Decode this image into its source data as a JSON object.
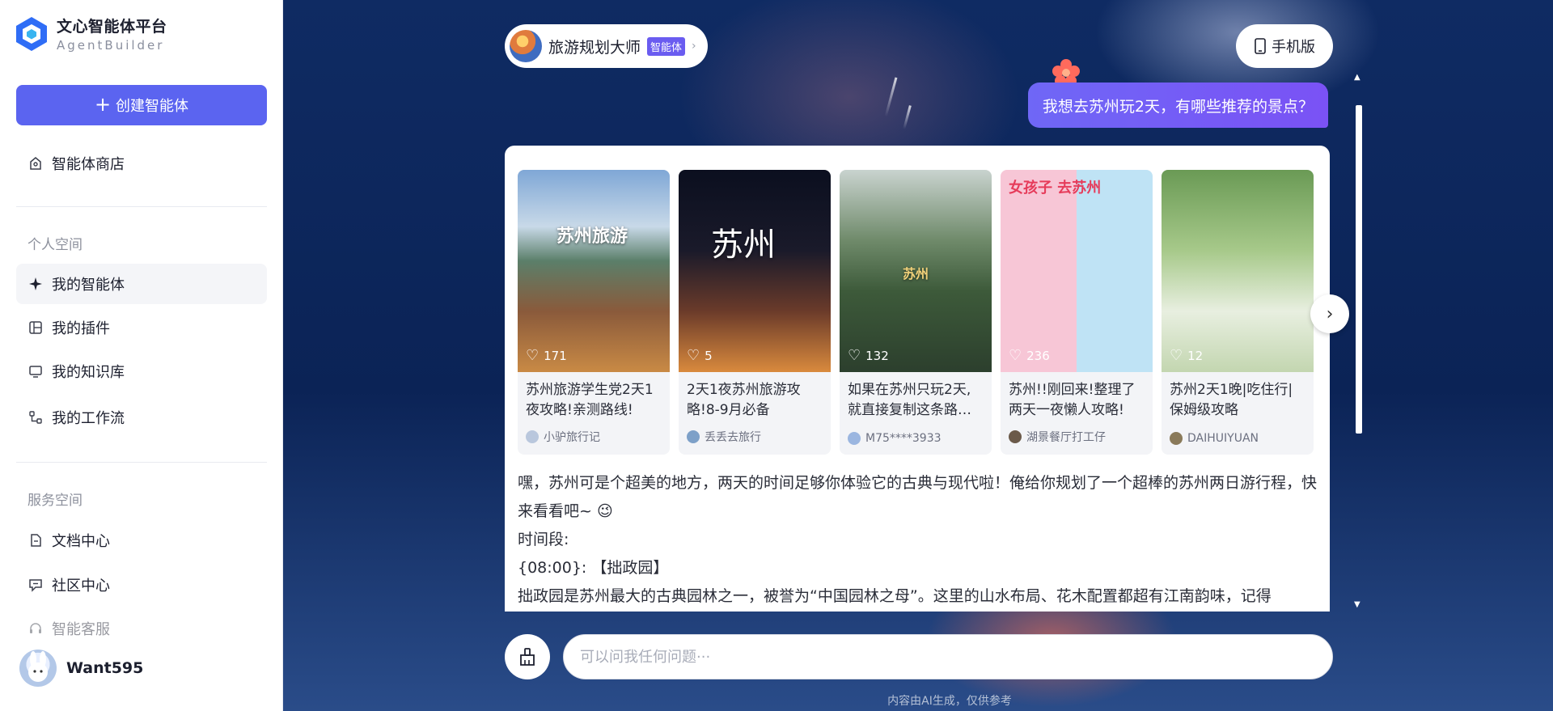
{
  "app": {
    "logo_title": "文心智能体平台",
    "logo_subtitle": "AgentBuilder"
  },
  "sidebar": {
    "create_button": "创建智能体",
    "store": "智能体商店",
    "personal_section": "个人空间",
    "personal_items": [
      "我的智能体",
      "我的插件",
      "我的知识库",
      "我的工作流"
    ],
    "service_section": "服务空间",
    "service_items": [
      "文档中心",
      "社区中心",
      "智能客服"
    ],
    "username": "Want595"
  },
  "header": {
    "agent_name": "旅游规划大师",
    "agent_tag": "智能体",
    "mobile_button": "手机版"
  },
  "chat": {
    "user_message": "我想去苏州玩2天，有哪些推荐的景点？",
    "cards": [
      {
        "title": "苏州旅游学生党2天1夜攻略!亲测路线!",
        "author": "小驴旅行记",
        "likes": "171",
        "img_text": "苏州旅游"
      },
      {
        "title": "2天1夜苏州旅游攻略!8-9月必备",
        "author": "丢丢去旅行",
        "likes": "5",
        "img_text": "苏州"
      },
      {
        "title": "如果在苏州只玩2天,就直接复制这条路…",
        "author": "M75****3933",
        "likes": "132",
        "img_text": "苏州"
      },
      {
        "title": "苏州!!刚回来!整理了两天一夜懒人攻略!",
        "author": "湖景餐厅打工仔",
        "likes": "236",
        "img_text": "女孩子 去苏州"
      },
      {
        "title": "苏州2天1晚|吃住行|保姆级攻略",
        "author": "DAIHUIYUAN",
        "likes": "12",
        "img_text": ""
      }
    ],
    "answer_lines": [
      "嘿，苏州可是个超美的地方，两天的时间足够你体验它的古典与现代啦！俺给你规划了一个超棒的苏州两日游行程，快来看看吧~ 😉",
      "时间段:",
      "{08:00}: 【拙政园】",
      "拙政园是苏州最大的古典园林之一，被誉为“中国园林之母”。这里的山水布局、花木配置都超有江南韵味，记得"
    ]
  },
  "input": {
    "placeholder": "可以问我任何问题···"
  },
  "footer": {
    "disclaimer": "内容由AI生成，仅供参考"
  },
  "colors": {
    "accent": "#5b64f0",
    "user_bubble": "#7060f6",
    "background": "#0d2456"
  }
}
